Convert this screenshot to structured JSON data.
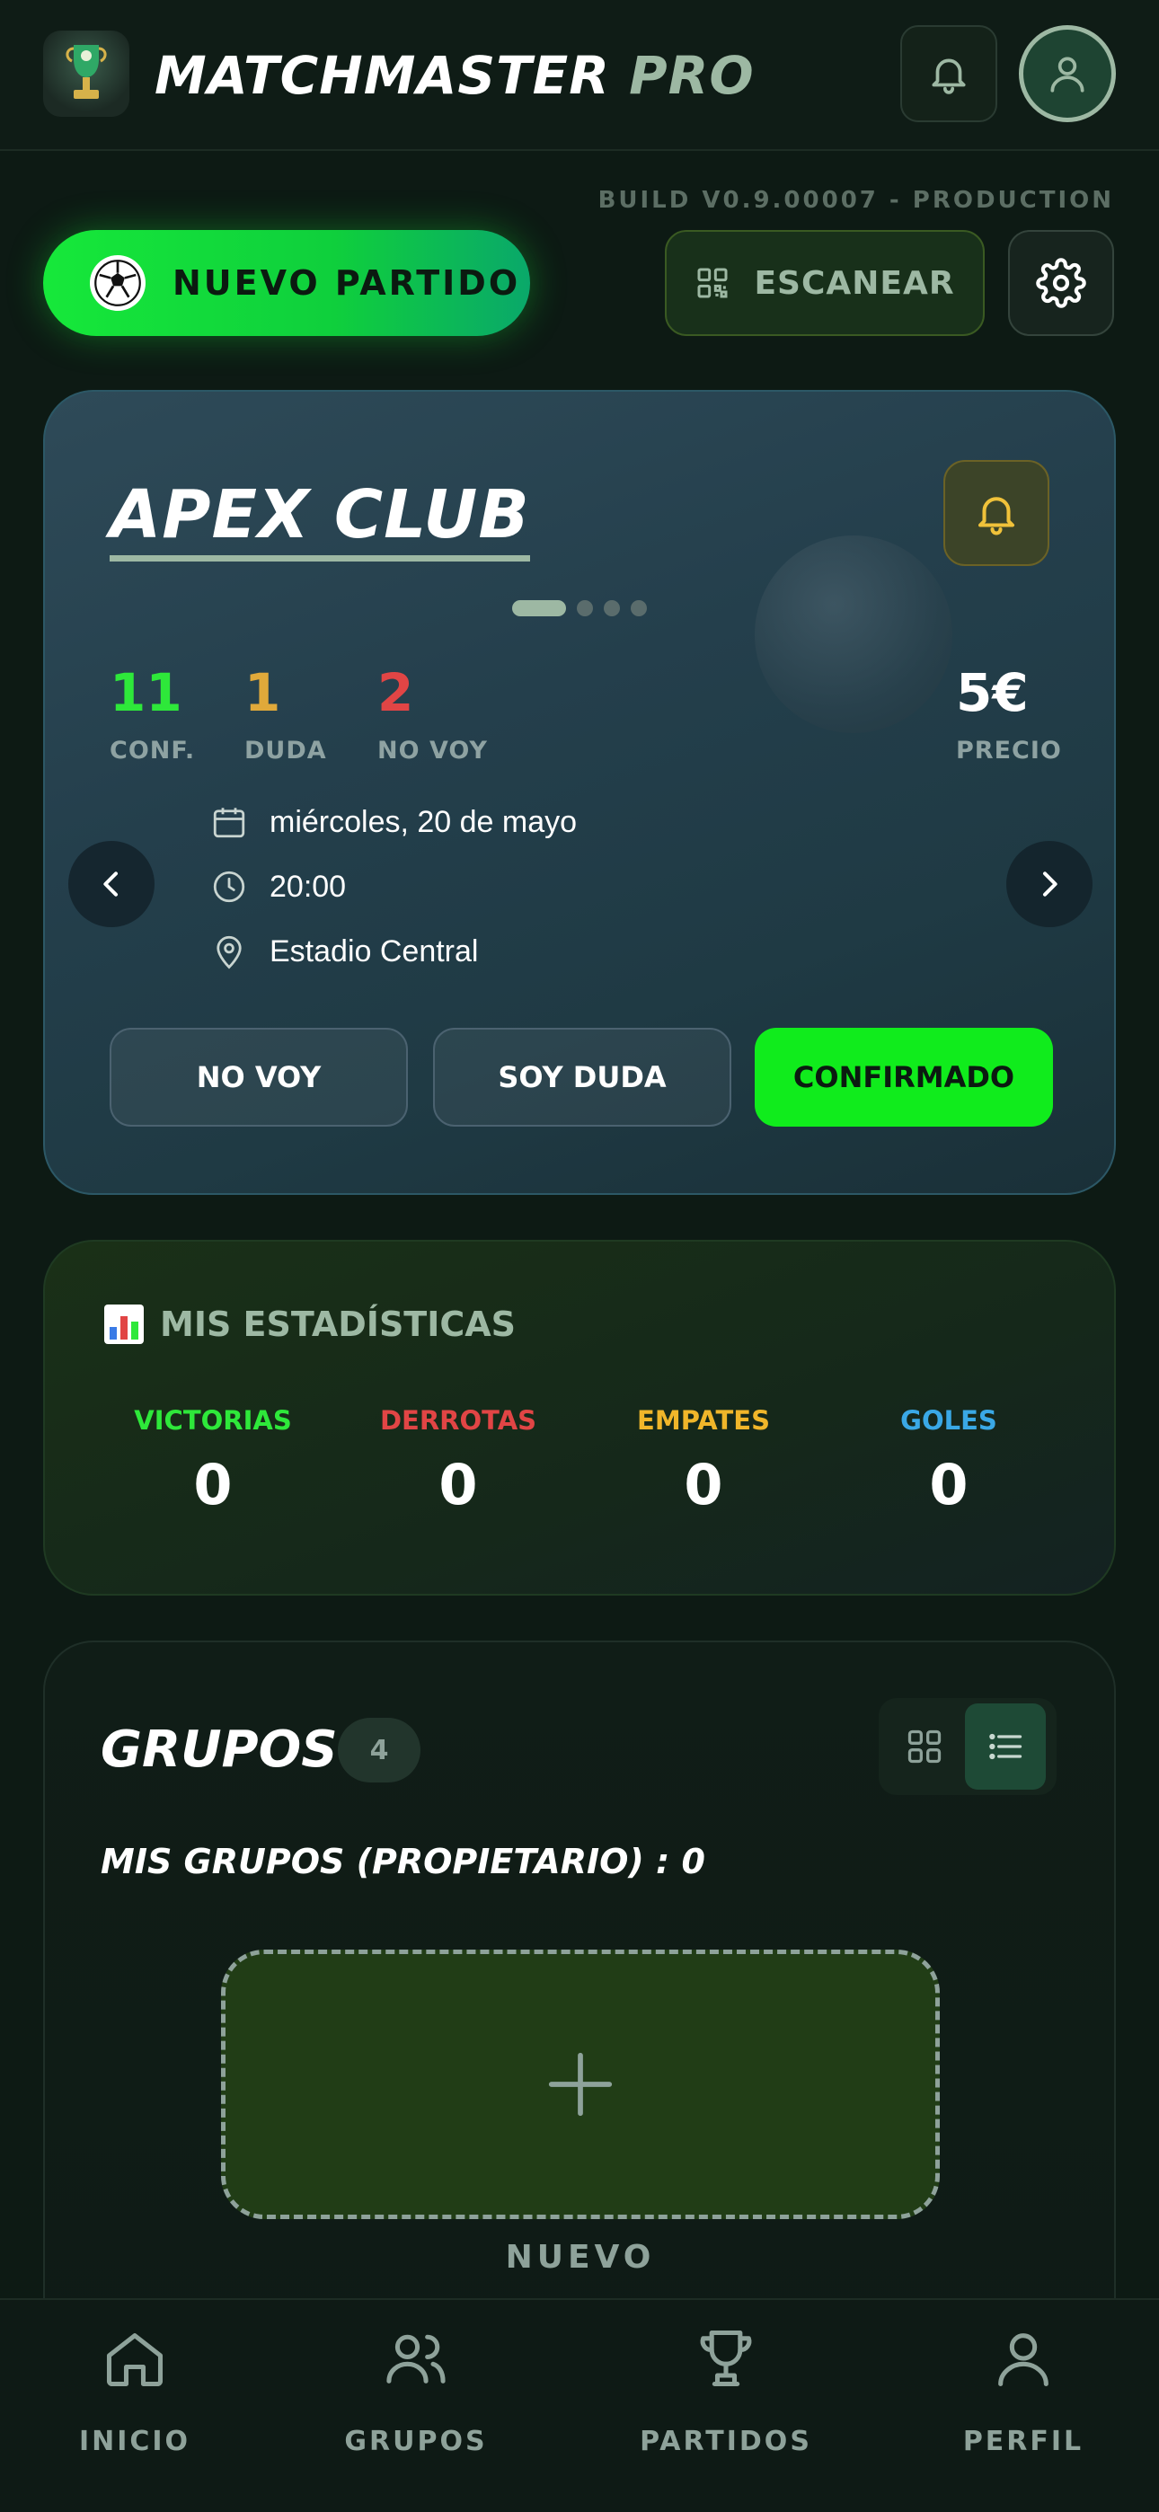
{
  "header": {
    "title_main": "MATCHMASTER",
    "title_suffix": "PRO",
    "build": "BUILD V0.9.00007 - PRODUCTION"
  },
  "actions": {
    "new_match_label": "NUEVO PARTIDO",
    "scan_label": "ESCANEAR"
  },
  "match": {
    "club": "APEX CLUB",
    "carousel_total": 4,
    "carousel_active": 1,
    "confirmed": {
      "value": "11",
      "label": "CONF.",
      "color": "#2ee83a"
    },
    "doubt": {
      "value": "1",
      "label": "DUDA",
      "color": "#e0a93a"
    },
    "not_going": {
      "value": "2",
      "label": "NO VOY",
      "color": "#e14545"
    },
    "price": {
      "value": "5€",
      "label": "PRECIO"
    },
    "date": "miércoles, 20 de mayo",
    "time": "20:00",
    "location": "Estadio Central",
    "buttons": {
      "no_voy": "NO VOY",
      "soy_duda": "SOY DUDA",
      "confirmado": "CONFIRMADO"
    }
  },
  "stats": {
    "title": "MIS ESTADÍSTICAS",
    "items": [
      {
        "label": "VICTORIAS",
        "value": "0",
        "color": "#2ee83a"
      },
      {
        "label": "DERROTAS",
        "value": "0",
        "color": "#e14545"
      },
      {
        "label": "EMPATES",
        "value": "0",
        "color": "#f0b62a"
      },
      {
        "label": "GOLES",
        "value": "0",
        "color": "#3aa8e6"
      }
    ]
  },
  "groups": {
    "title": "GRUPOS",
    "count": "4",
    "owner_label": "MIS GRUPOS (PROPIETARIO) : 0",
    "new_label": "NUEVO"
  },
  "nav": {
    "items": [
      {
        "label": "INICIO",
        "icon": "home-icon"
      },
      {
        "label": "GRUPOS",
        "icon": "users-icon"
      },
      {
        "label": "PARTIDOS",
        "icon": "trophy-icon"
      },
      {
        "label": "PERFIL",
        "icon": "user-icon"
      }
    ]
  },
  "colors": {
    "accent": "#10ec1c",
    "muted": "#9db8a3",
    "background": "#0d1a14"
  }
}
